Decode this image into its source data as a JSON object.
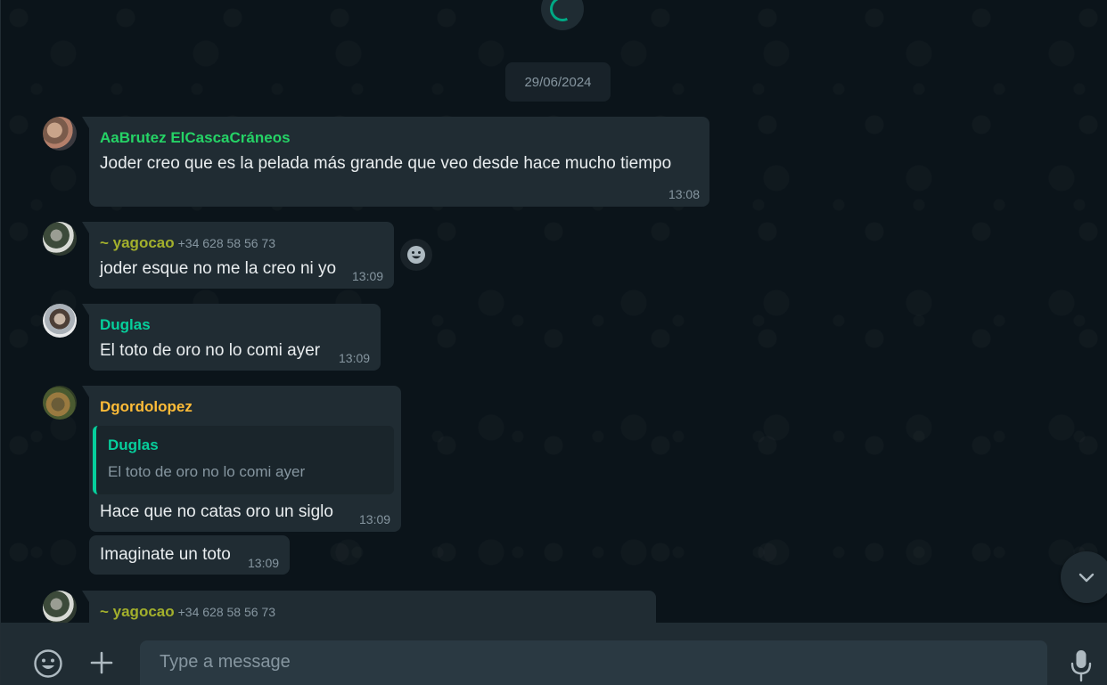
{
  "date_chip": "29/06/2024",
  "messages": [
    {
      "sender": "AaBrutez ElCascaCráneos",
      "phone": "",
      "text": "Joder creo que es la pelada más grande que veo desde hace mucho tiempo",
      "time": "13:08"
    },
    {
      "sender": "~ yagocao",
      "phone": "+34 628 58 56 73",
      "text": "joder esque no me la creo ni yo",
      "time": "13:09"
    },
    {
      "sender": "Duglas",
      "phone": "",
      "text": "El toto de oro no lo comi ayer",
      "time": "13:09"
    },
    {
      "sender": "Dgordolopez",
      "phone": "",
      "quote": {
        "name": "Duglas",
        "text": "El toto de oro no lo comi ayer"
      },
      "text": "Hace que no catas oro un siglo",
      "time": "13:09"
    },
    {
      "sender": "",
      "phone": "",
      "text": "Imaginate un toto",
      "time": "13:09"
    },
    {
      "sender": "~ yagocao",
      "phone": "+34 628 58 56 73",
      "text": "",
      "time": ""
    }
  ],
  "composer": {
    "placeholder": "Type a message"
  },
  "icons": {
    "emoji": "emoji-icon",
    "attach": "plus-icon",
    "mic": "microphone-icon",
    "react": "reaction-smiley-icon",
    "scroll": "chevron-down-icon",
    "loading": "loading-spinner-icon"
  },
  "colors": {
    "background": "#0b141a",
    "bubble": "#202c33",
    "accent": "#00a884",
    "name_green": "#25d366",
    "name_olive": "#a3b02c",
    "name_teal": "#06cf9c",
    "name_orange": "#ffbc38"
  }
}
